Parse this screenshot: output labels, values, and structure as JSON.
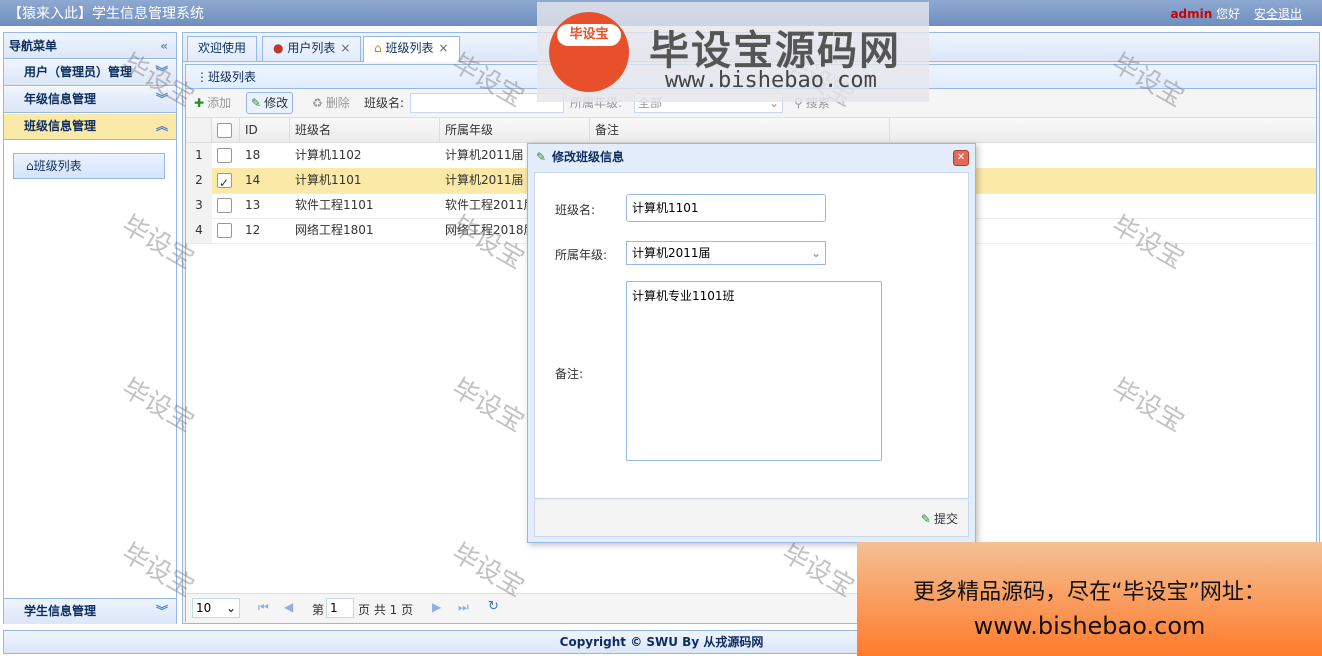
{
  "header": {
    "title": "【猿来入此】学生信息管理系统",
    "user": "admin",
    "greeting": "您好",
    "logout": "安全退出"
  },
  "nav": {
    "title": "导航菜单",
    "sections": [
      {
        "label": "用户（管理员）管理"
      },
      {
        "label": "年级信息管理"
      },
      {
        "label": "班级信息管理"
      }
    ],
    "active_item": "班级列表",
    "bottom_section": "学生信息管理"
  },
  "tabs": [
    {
      "label": "欢迎使用"
    },
    {
      "label": "用户列表"
    },
    {
      "label": "班级列表"
    }
  ],
  "panel": {
    "title": "班级列表",
    "toolbar": {
      "add": "添加",
      "edit": "修改",
      "delete": "删除",
      "class_name_label": "班级名:",
      "grade_label": "所属年级:",
      "grade_value": "全部",
      "search": "搜索"
    },
    "columns": [
      "ID",
      "班级名",
      "所属年级",
      "备注"
    ],
    "rows": [
      {
        "num": "1",
        "id": "18",
        "name": "计算机1102",
        "grade": "计算机2011届",
        "selected": false
      },
      {
        "num": "2",
        "id": "14",
        "name": "计算机1101",
        "grade": "计算机2011届",
        "selected": true
      },
      {
        "num": "3",
        "id": "13",
        "name": "软件工程1101",
        "grade": "软件工程2011届",
        "selected": false
      },
      {
        "num": "4",
        "id": "12",
        "name": "网络工程1801",
        "grade": "网络工程2018届",
        "selected": false
      }
    ],
    "pager": {
      "page_size": "10",
      "page_prefix": "第",
      "page_value": "1",
      "page_suffix": "页 共 1 页"
    }
  },
  "dialog": {
    "title": "修改班级信息",
    "name_label": "班级名:",
    "name_value": "计算机1101",
    "grade_label": "所属年级:",
    "grade_value": "计算机2011届",
    "remark_label": "备注:",
    "remark_value": "计算机专业1101班",
    "submit": "提交"
  },
  "footer": "Copyright © SWU By 从戎源码网",
  "watermark": {
    "text": "毕设宝",
    "logo_badge": "毕设宝",
    "logo_main": "毕设宝源码网",
    "logo_url": "www.bishebao.com"
  },
  "banner": {
    "line1": "更多精品源码，尽在“毕设宝”网址：",
    "line2": "www.bishebao.com"
  },
  "colors": {
    "accent": "#95b8e7",
    "selected_row": "#fbe9a8",
    "admin": "#d00000",
    "banner_bottom": "#ff7b2c"
  }
}
